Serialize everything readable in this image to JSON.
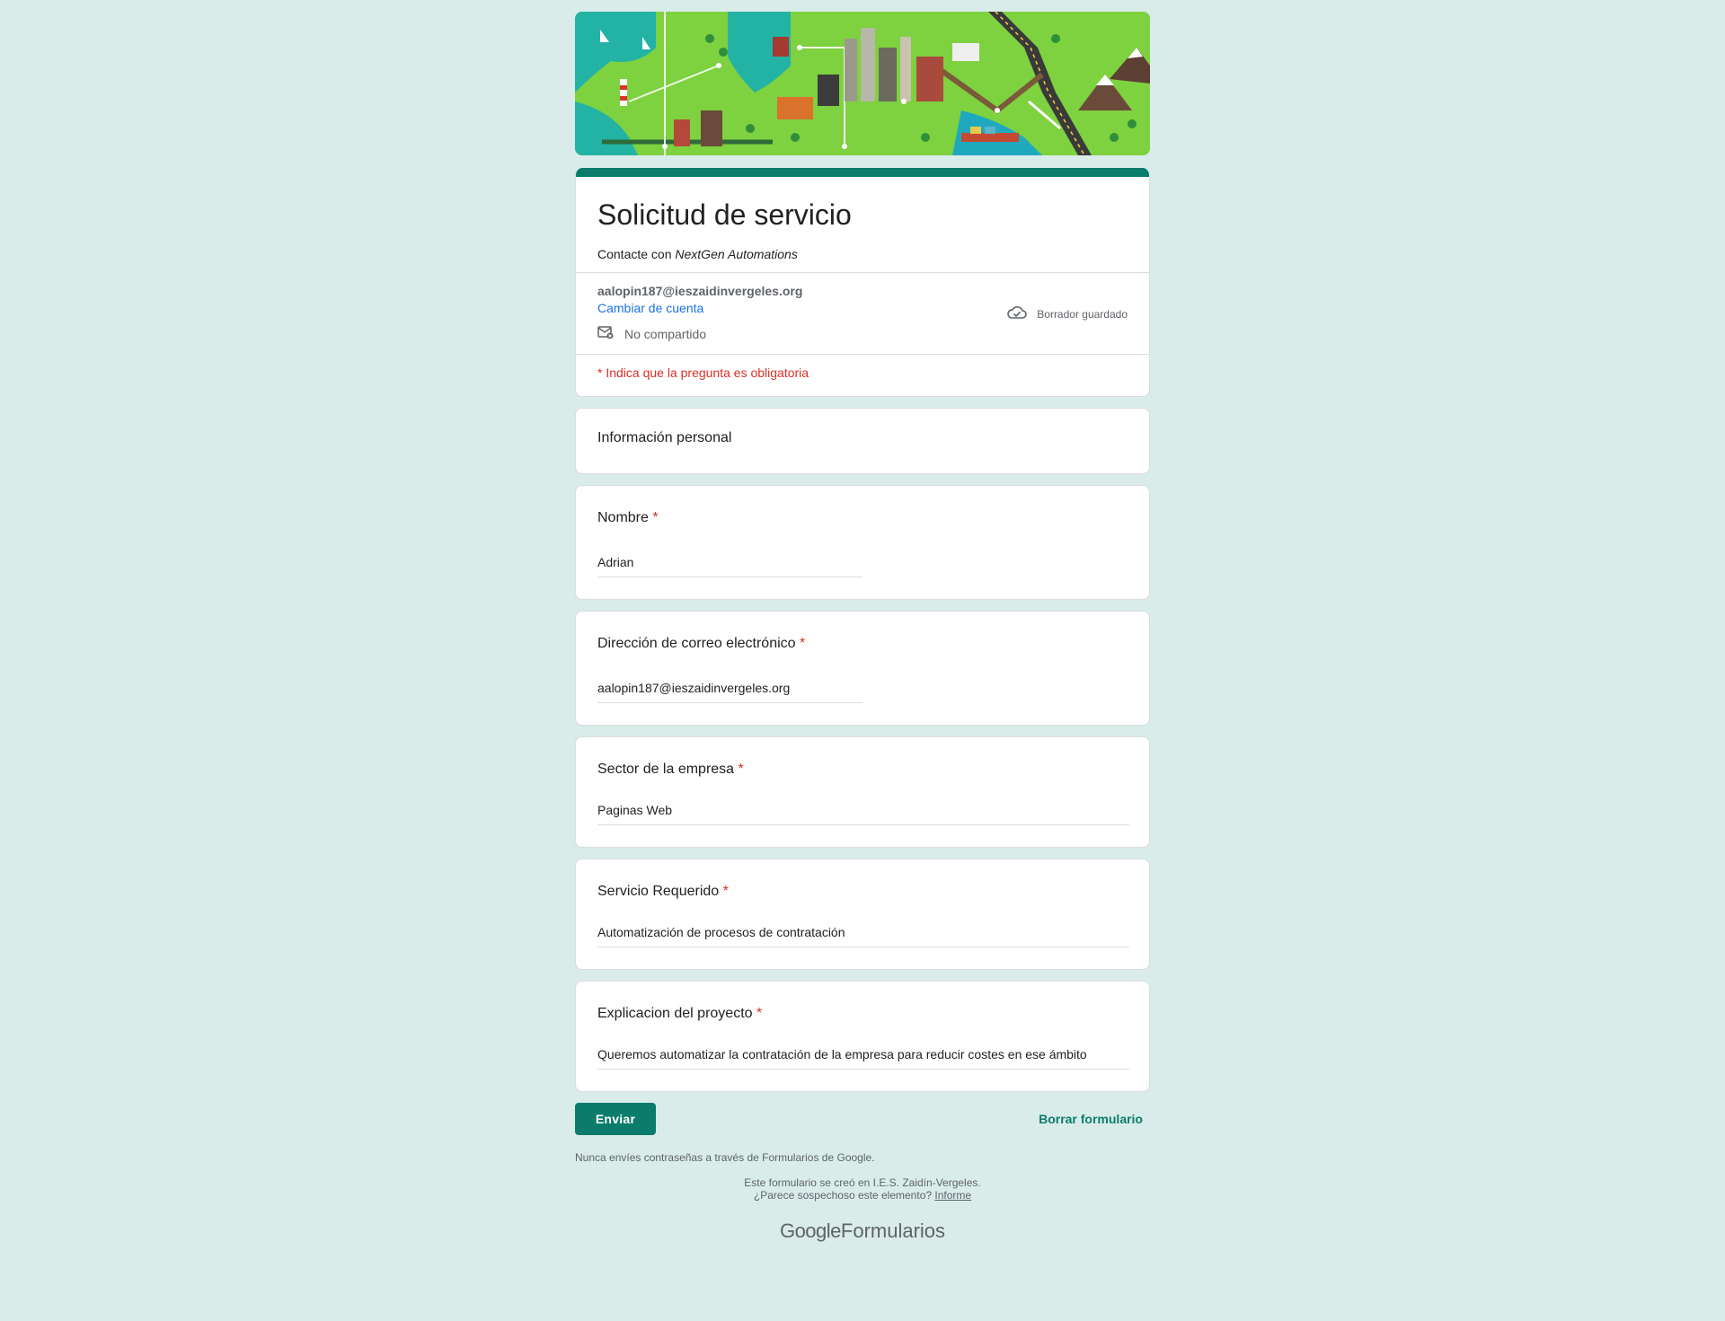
{
  "form": {
    "title": "Solicitud de servicio",
    "description_prefix": "Contacte con ",
    "description_company": "NextGen Automations",
    "account_email": "aalopin187@ieszaidinvergeles.org",
    "switch_account": "Cambiar de cuenta",
    "not_shared": "No compartido",
    "draft_saved": "Borrador guardado",
    "required_note": "* Indica que la pregunta es obligatoria"
  },
  "section": {
    "title": "Información personal"
  },
  "questions": [
    {
      "label": "Nombre",
      "required": "*",
      "answer": "Adrian"
    },
    {
      "label": "Dirección de correo electrónico",
      "required": "*",
      "answer": "aalopin187@ieszaidinvergeles.org"
    },
    {
      "label": "Sector de la empresa",
      "required": "*",
      "answer": "Paginas Web"
    },
    {
      "label": "Servicio Requerido",
      "required": "*",
      "answer": "Automatización de procesos de contratación"
    },
    {
      "label": "Explicacion del proyecto",
      "required": "*",
      "answer": "Queremos automatizar la contratación de la empresa para reducir costes en ese ámbito"
    }
  ],
  "actions": {
    "submit": "Enviar",
    "clear": "Borrar formulario"
  },
  "footer": {
    "warning": "Nunca envíes contraseñas a través de Formularios de Google.",
    "created_in": "Este formulario se creó en I.E.S. Zaidín-Vergeles.",
    "suspicious": "¿Parece sospechoso este elemento? ",
    "report": "Informe",
    "brand_google": "Google",
    "brand_product": "Formularios"
  },
  "colors": {
    "accent": "#0b7c6b",
    "background": "#d9ecea",
    "required": "#d93025",
    "link": "#1a73e8"
  },
  "icons": {
    "draft": "cloud-check-icon",
    "share": "mail-off-icon"
  }
}
